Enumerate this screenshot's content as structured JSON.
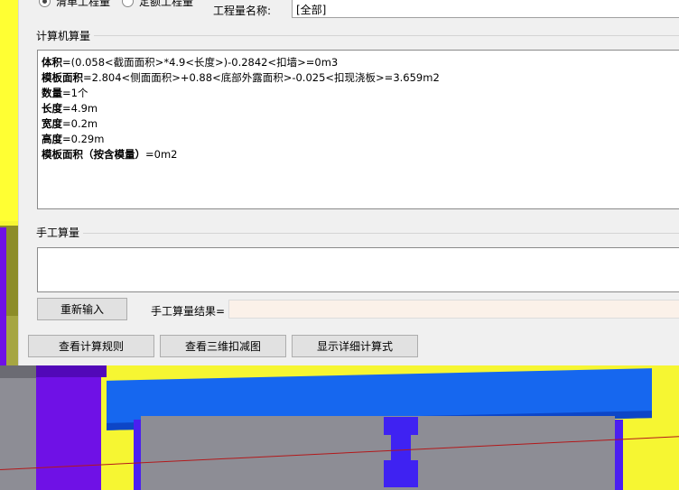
{
  "header": {
    "radio_qingdan": "清单工程量",
    "radio_dinge": "定额工程量",
    "qty_name_label": "工程量名称:",
    "qty_name_value": "[全部]"
  },
  "computer_calc": {
    "title": "计算机算量",
    "lines": [
      {
        "label": "体积",
        "expr": "=(0.058<截面面积>*4.9<长度>)-0.2842<扣墙>=0m3"
      },
      {
        "label": "模板面积",
        "expr": "=2.804<侧面面积>+0.88<底部外露面积>-0.025<扣现浇板>=3.659m2"
      },
      {
        "label": "数量",
        "expr": "=1个"
      },
      {
        "label": "长度",
        "expr": "=4.9m"
      },
      {
        "label": "宽度",
        "expr": "=0.2m"
      },
      {
        "label": "高度",
        "expr": "=0.29m"
      },
      {
        "label": "模板面积（按含模量）",
        "expr": "=0m2"
      }
    ]
  },
  "manual_calc": {
    "title": "手工算量",
    "reinput_button": "重新输入",
    "result_label": "手工算量结果="
  },
  "buttons": {
    "view_rules": "查看计算规则",
    "view_3d": "查看三维扣减图",
    "show_detail": "显示详细计算式"
  }
}
